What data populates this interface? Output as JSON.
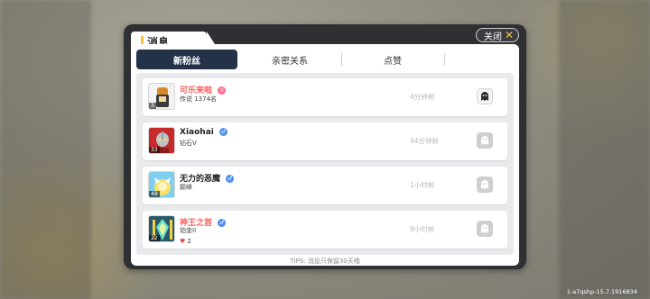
{
  "dialog": {
    "title": "消息",
    "close_label": "关闭"
  },
  "tabs": [
    {
      "label": "新粉丝",
      "active": true
    },
    {
      "label": "亲密关系",
      "active": false
    },
    {
      "label": "点赞",
      "active": false
    },
    {
      "label": "",
      "active": false
    }
  ],
  "messages": [
    {
      "name": "可乐来啦",
      "name_color": "#ff5c5c",
      "gender": "female",
      "rank": "传说 1374名",
      "time": "4分钟前",
      "level": "3",
      "action_enabled": true
    },
    {
      "name": "Xiaohai",
      "name_color": "#222222",
      "gender": "male",
      "rank": "钻石V",
      "time": "44分钟前",
      "level": "33",
      "action_enabled": false
    },
    {
      "name": "无力的恶魔",
      "name_color": "#222222",
      "gender": "male",
      "rank": "巅峰",
      "time": "1小时前",
      "level": "48",
      "action_enabled": false
    },
    {
      "name": "神王之首",
      "name_color": "#ff5c5c",
      "gender": "male",
      "rank": "铂金II",
      "likes": "2",
      "time": "9小时前",
      "level": "22",
      "action_enabled": false
    }
  ],
  "tips": "TIPS: 消息只保留30天哦",
  "version": "1-a7qshp-15.7.1916834",
  "colors": {
    "tab_active_bg": "#233149",
    "accent": "#f3c23a",
    "female": "#ff6b8a",
    "male": "#4a8ef0"
  }
}
